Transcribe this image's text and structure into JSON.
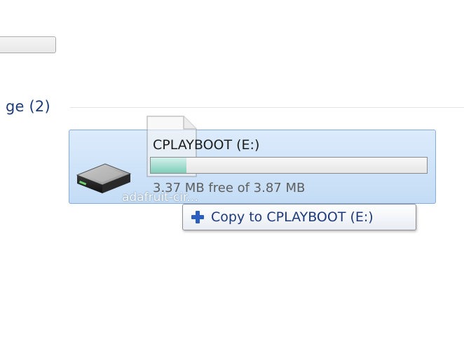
{
  "group": {
    "label": "ge (2)"
  },
  "drive": {
    "name": "CPLAYBOOT (E:)",
    "free_space_text": "3.37 MB free of 3.87 MB",
    "used_fraction": 0.13,
    "icon": "drive-icon"
  },
  "drag": {
    "file_name": "adafruit-cir...",
    "tooltip_text": "Copy to CPLAYBOOT (E:)",
    "tooltip_icon": "plus-icon"
  },
  "colors": {
    "accent": "#1e3a7a",
    "tile_bg": "#cfe3f8",
    "tile_border": "#84acdd",
    "capacity_fill": "#8fd3c2",
    "plus": "#2a5fc0"
  }
}
